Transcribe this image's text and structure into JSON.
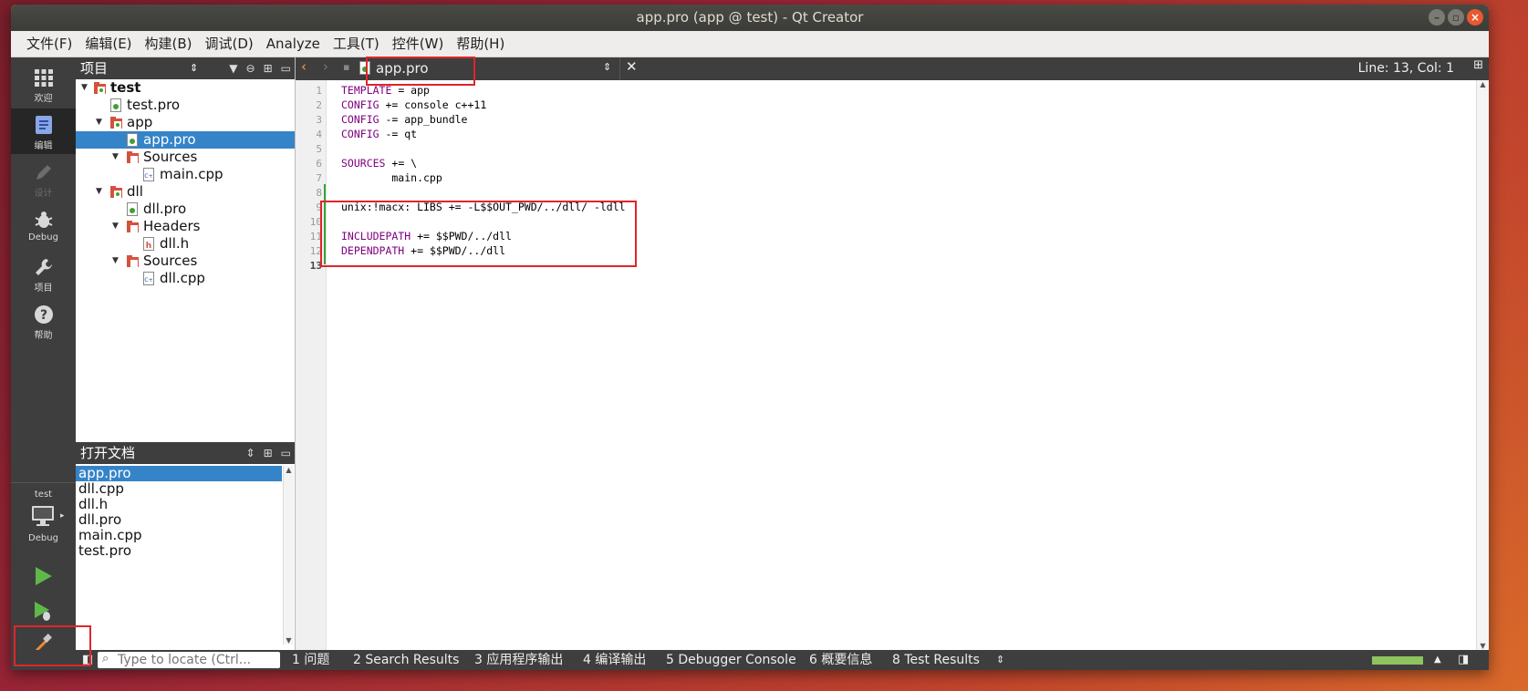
{
  "window": {
    "title": "app.pro (app @ test) - Qt Creator"
  },
  "menu": [
    "文件(F)",
    "编辑(E)",
    "构建(B)",
    "调试(D)",
    "Analyze",
    "工具(T)",
    "控件(W)",
    "帮助(H)"
  ],
  "modes": [
    {
      "label": "欢迎",
      "icon": "grid-icon"
    },
    {
      "label": "编辑",
      "icon": "edit-icon"
    },
    {
      "label": "设计",
      "icon": "pencil-icon"
    },
    {
      "label": "Debug",
      "icon": "bug-icon"
    },
    {
      "label": "项目",
      "icon": "wrench-icon"
    },
    {
      "label": "帮助",
      "icon": "help-icon"
    }
  ],
  "kit": {
    "project": "test",
    "config": "Debug"
  },
  "projects": {
    "title": "项目",
    "tree": [
      "test",
      "test.pro",
      "app",
      "app.pro",
      "Sources",
      "main.cpp",
      "dll",
      "dll.pro",
      "Headers",
      "dll.h",
      "Sources",
      "dll.cpp"
    ]
  },
  "open_docs": {
    "title": "打开文档",
    "items": [
      "app.pro",
      "dll.cpp",
      "dll.h",
      "dll.pro",
      "main.cpp",
      "test.pro"
    ]
  },
  "editor": {
    "tab": "app.pro",
    "position": "Line: 13, Col: 1",
    "line_numbers": [
      "1",
      "2",
      "3",
      "4",
      "5",
      "6",
      "7",
      "8",
      "9",
      "10",
      "11",
      "12",
      "13"
    ],
    "lines": [
      {
        "k": "TEMPLATE",
        "r": " = app"
      },
      {
        "k": "CONFIG",
        "r": " += console c++11"
      },
      {
        "k": "CONFIG",
        "r": " -= app_bundle"
      },
      {
        "k": "CONFIG",
        "r": " -= qt"
      },
      {
        "k": "",
        "r": ""
      },
      {
        "k": "SOURCES",
        "r": " += \\"
      },
      {
        "k": "",
        "r": "        main.cpp"
      },
      {
        "k": "",
        "r": ""
      },
      {
        "k": "",
        "r": "unix:!macx: LIBS += -L$$OUT_PWD/../dll/ -ldll"
      },
      {
        "k": "",
        "r": ""
      },
      {
        "k": "INCLUDEPATH",
        "r": " += $$PWD/../dll"
      },
      {
        "k": "DEPENDPATH",
        "r": " += $$PWD/../dll"
      },
      {
        "k": "",
        "r": ""
      }
    ]
  },
  "locator": {
    "placeholder": "Type to locate (Ctrl..."
  },
  "output_tabs": [
    "1  问题",
    "2  Search Results",
    "3  应用程序输出",
    "4  编译输出",
    "5  Debugger Console",
    "6  概要信息",
    "8  Test Results"
  ],
  "colors": {
    "accent": "#3584c8",
    "highlight_box": "#e0252b",
    "keyword": "#800080"
  }
}
